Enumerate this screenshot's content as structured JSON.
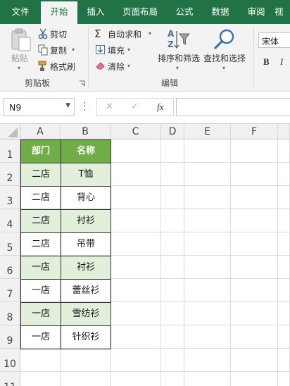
{
  "ribbon": {
    "tabs": [
      "文件",
      "开始",
      "插入",
      "页面布局",
      "公式",
      "数据",
      "审阅",
      "视"
    ],
    "active_tab": "开始",
    "clipboard": {
      "paste_label": "粘贴",
      "cut_label": "剪切",
      "copy_label": "复制",
      "format_painter_label": "格式刷",
      "group_label": "剪贴板"
    },
    "editing": {
      "autosum_label": "自动求和",
      "fill_label": "填充",
      "clear_label": "清除",
      "sort_filter_label": "排序和筛选",
      "find_select_label": "查找和选择",
      "group_label": "编辑"
    },
    "font": {
      "font_name": "宋体",
      "bold_label": "B",
      "italic_label": "I"
    }
  },
  "formula_bar": {
    "name_box": "N9",
    "cancel_symbol": "✕",
    "enter_symbol": "✓",
    "fx_label": "fx",
    "formula": ""
  },
  "sheet": {
    "columns": [
      "A",
      "B",
      "C",
      "D",
      "E",
      "F"
    ],
    "rows": [
      "1",
      "2",
      "3",
      "4",
      "5",
      "6",
      "7",
      "8",
      "9",
      "10",
      "11"
    ],
    "table": {
      "headers": [
        "部门",
        "名称"
      ],
      "rows": [
        [
          "二店",
          "T恤"
        ],
        [
          "二店",
          "背心"
        ],
        [
          "二店",
          "衬衫"
        ],
        [
          "二店",
          "吊带"
        ],
        [
          "一店",
          "衬衫"
        ],
        [
          "一店",
          "蕾丝衫"
        ],
        [
          "一店",
          "雪纺衫"
        ],
        [
          "一店",
          "针织衫"
        ]
      ]
    }
  },
  "colors": {
    "ribbon_green": "#217346",
    "header_fill": "#70ad47",
    "band_fill": "#e2efda"
  }
}
